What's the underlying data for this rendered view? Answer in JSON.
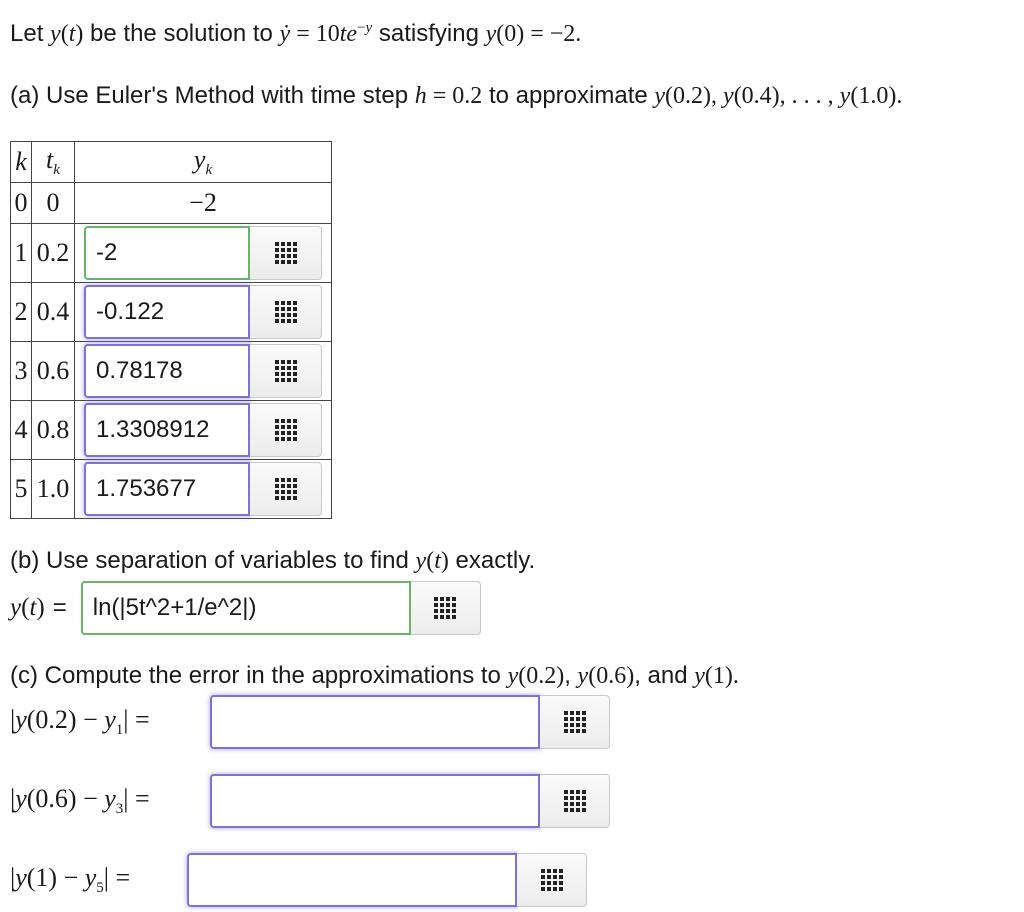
{
  "intro": {
    "let": "Let",
    "be": "be the solution to",
    "satisfying": "satisfying"
  },
  "part_a": {
    "label": "(a) Use Euler's Method with time step",
    "to": "to approximate"
  },
  "table": {
    "header": {
      "k": "k",
      "t": "t",
      "y": "y",
      "sub": "k"
    },
    "row0": {
      "k": "0",
      "t": "0",
      "y": "−2"
    },
    "rows": [
      {
        "k": "1",
        "t": "0.2",
        "value": "-2"
      },
      {
        "k": "2",
        "t": "0.4",
        "value": "-0.122"
      },
      {
        "k": "3",
        "t": "0.6",
        "value": "0.78178"
      },
      {
        "k": "4",
        "t": "0.8",
        "value": "1.3308912"
      },
      {
        "k": "5",
        "t": "1.0",
        "value": "1.753677"
      }
    ]
  },
  "part_b": {
    "label": "(b) Use separation of variables to find",
    "exactly": "exactly.",
    "equals": "=",
    "answer": "ln(|5t^2+1/e^2|)"
  },
  "part_c": {
    "label": "(c) Compute the error in the approximations to",
    "comma": ",",
    "and": "and",
    "fields": [
      {
        "value": ""
      },
      {
        "value": ""
      },
      {
        "value": ""
      }
    ]
  },
  "icons": {
    "matrix": "grid-icon"
  },
  "colors": {
    "focus_border": "#7c73d4",
    "correct_border": "#6ab46a"
  }
}
